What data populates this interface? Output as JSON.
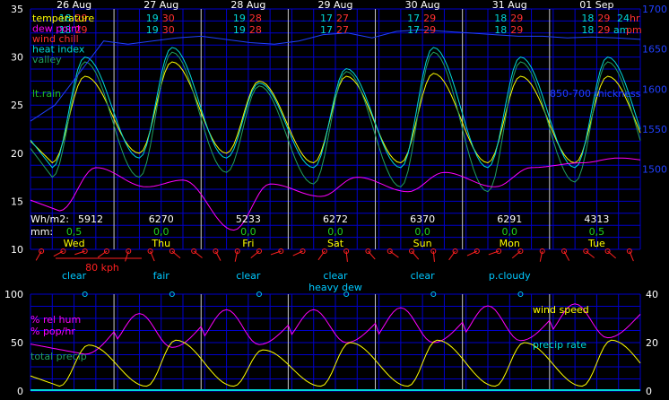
{
  "colors": {
    "background": "#000000",
    "grid": "#0000cc",
    "midnight_line": "#c8c8c8",
    "temperature": "#ffff00",
    "dew_point": "#ff00ff",
    "wind_chill": "#ff3030",
    "heat_index": "#00d8d8",
    "valley": "#20a060",
    "min_temp": "#00d8d8",
    "max_temp": "#ff3030",
    "rain_label": "#20c020",
    "snow_line": "#2040ff",
    "daily_stats": "#ffffff",
    "daily_precip": "#20d020",
    "day_name": "#ffff00",
    "wind_marker": "#ff2020",
    "sky_label": "#00c8ff",
    "sky_dot": "#00c8ff",
    "rel_hum": "#ff00ff",
    "wind_speed": "#ffff00",
    "precip_rate": "#00d8d8",
    "total_precip": "#20a060"
  },
  "chart_data": [
    {
      "type": "line",
      "title": "",
      "x_axis": {
        "unit": "hours",
        "range": [
          0,
          168
        ],
        "date_labels": [
          {
            "hour": 0,
            "label": "26 Aug"
          },
          {
            "hour": 24,
            "label": "27 Aug"
          },
          {
            "hour": 48,
            "label": "28 Aug"
          },
          {
            "hour": 72,
            "label": "29 Aug"
          },
          {
            "hour": 96,
            "label": "30 Aug"
          },
          {
            "hour": 120,
            "label": "31 Aug"
          },
          {
            "hour": 144,
            "label": "01 Sep"
          }
        ],
        "midnights": [
          23,
          47,
          71,
          95,
          119,
          143
        ]
      },
      "y_left": {
        "range": [
          10,
          35
        ],
        "ticks": [
          "10",
          "15",
          "20",
          "25",
          "30",
          "35"
        ]
      },
      "y_right": {
        "range": [
          1400,
          1700
        ],
        "ticks": [
          "1500",
          "1550",
          "1600",
          "1650",
          "1700"
        ],
        "label": "850-700 thickness"
      },
      "legend": [
        "temperature",
        "dew point",
        "wind chill",
        "heat index",
        "valley",
        "lt.rain"
      ],
      "minmax_header": {
        "row1_suffix": "24 hr",
        "row2_suffix": "am pm",
        "days": [
          {
            "min24": "18",
            "max24": "29",
            "min_am": "18",
            "max_pm": "29"
          },
          {
            "min24": "19",
            "max24": "30",
            "min_am": "19",
            "max_pm": "30"
          },
          {
            "min24": "19",
            "max24": "28",
            "min_am": "19",
            "max_pm": "28"
          },
          {
            "min24": "17",
            "max24": "27",
            "min_am": "17",
            "max_pm": "27"
          },
          {
            "min24": "17",
            "max24": "29",
            "min_am": "17",
            "max_pm": "29"
          },
          {
            "min24": "18",
            "max24": "29",
            "min_am": "18",
            "max_pm": "29"
          },
          {
            "min24": "18",
            "max24": "29",
            "min_am": "18",
            "max_pm": "29"
          }
        ]
      },
      "daily": {
        "row_labels": [
          "Wh/m2:",
          "mm:"
        ],
        "radiation": [
          "5912",
          "6270",
          "5233",
          "6272",
          "6370",
          "6291",
          "4313"
        ],
        "precip_mm": [
          "0,5",
          "0,0",
          "0,0",
          "0,0",
          "0,0",
          "0,0",
          "0,5"
        ],
        "day_names": [
          "Wed",
          "Thu",
          "Fri",
          "Sat",
          "Sun",
          "Mon",
          "Tue"
        ]
      },
      "wind_scale_label": "80 kph",
      "series_daily_shape": [
        {
          "name": "temperature",
          "min": [
            19,
            20,
            20,
            19,
            19,
            19,
            19
          ],
          "max": [
            28,
            29.5,
            27.5,
            28,
            28.3,
            28,
            28
          ]
        },
        {
          "name": "heat index",
          "min": [
            18.5,
            19.5,
            19.5,
            18.5,
            18.5,
            18.5,
            18.5
          ],
          "max": [
            30,
            31,
            27.3,
            28.8,
            31,
            30,
            30
          ]
        },
        {
          "name": "valley",
          "min": [
            17.5,
            17.5,
            18,
            16.8,
            16.5,
            16,
            17
          ],
          "max": [
            29.5,
            30.5,
            27,
            28.5,
            30.5,
            29.5,
            29.5
          ]
        },
        {
          "name": "dew point",
          "min": [
            14,
            16.5,
            12,
            15.5,
            16,
            16.5,
            19
          ],
          "max": [
            18.5,
            17.2,
            16.8,
            17.5,
            18,
            18.5,
            19.5
          ]
        }
      ],
      "thickness": [
        1560,
        1580,
        1620,
        1660,
        1656,
        1660,
        1664,
        1666,
        1662,
        1658,
        1656,
        1660,
        1668,
        1670,
        1664,
        1672,
        1674,
        1672,
        1670,
        1668,
        1666,
        1666,
        1664,
        1665,
        1664,
        1662
      ]
    },
    {
      "type": "line",
      "title": "",
      "y_left": {
        "range": [
          0,
          100
        ],
        "ticks": [
          "0",
          "50",
          "100"
        ]
      },
      "y_right": {
        "range": [
          0,
          40
        ],
        "ticks": [
          "0",
          "20",
          "40"
        ]
      },
      "legend_left": [
        "% rel hum",
        "% pop/hr",
        "total precip"
      ],
      "legend_right": [
        "wind speed",
        "precip rate"
      ],
      "sky_conditions": [
        {
          "hour": 12,
          "label": "clear"
        },
        {
          "hour": 36,
          "label": "fair"
        },
        {
          "hour": 60,
          "label": "clear"
        },
        {
          "hour": 84,
          "label": "clear"
        },
        {
          "hour": 108,
          "label": "clear"
        },
        {
          "hour": 132,
          "label": "p.cloudy"
        }
      ],
      "extra_label": "heavy dew",
      "rel_hum_daily": {
        "min": [
          38,
          45,
          48,
          50,
          50,
          52,
          55
        ],
        "max": [
          80,
          84,
          84,
          86,
          88,
          90,
          92
        ]
      },
      "wind_speed_daily_max": [
        19,
        21,
        17,
        20,
        21,
        20,
        21
      ]
    }
  ]
}
